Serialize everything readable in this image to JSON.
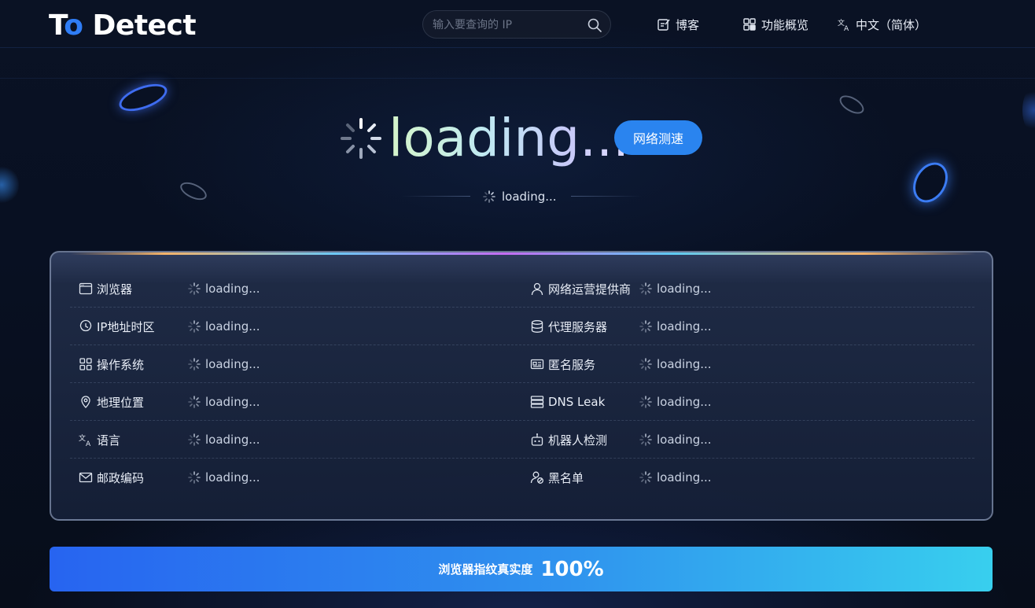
{
  "header": {
    "logo_text_a": "T",
    "logo_text_o": "o",
    "logo_text_b": " Detect",
    "search_placeholder": "输入要查询的 IP",
    "nav": {
      "blog": "博客",
      "features": "功能概览",
      "language": "中文（简体）"
    }
  },
  "hero": {
    "title": "loading...",
    "speed_test_button": "网络测速",
    "subtitle": "loading..."
  },
  "info": {
    "left": [
      {
        "label": "浏览器",
        "value": "loading...",
        "icon": "browser-icon"
      },
      {
        "label": "IP地址时区",
        "value": "loading...",
        "icon": "clock-icon"
      },
      {
        "label": "操作系统",
        "value": "loading...",
        "icon": "grid-icon"
      },
      {
        "label": "地理位置",
        "value": "loading...",
        "icon": "location-pin-icon"
      },
      {
        "label": "语言",
        "value": "loading...",
        "icon": "translate-icon"
      },
      {
        "label": "邮政编码",
        "value": "loading...",
        "icon": "mail-icon"
      }
    ],
    "right": [
      {
        "label": "网络运营提供商",
        "value": "loading...",
        "icon": "person-icon"
      },
      {
        "label": "代理服务器",
        "value": "loading...",
        "icon": "database-icon"
      },
      {
        "label": "匿名服务",
        "value": "loading...",
        "icon": "id-card-icon"
      },
      {
        "label": "DNS Leak",
        "value": "loading...",
        "icon": "server-list-icon"
      },
      {
        "label": "机器人检测",
        "value": "loading...",
        "icon": "robot-icon"
      },
      {
        "label": "黑名单",
        "value": "loading...",
        "icon": "user-block-icon"
      }
    ]
  },
  "score": {
    "label": "浏览器指纹真实度",
    "value": "100%"
  },
  "colors": {
    "accent": "#2a84ef",
    "background": "#070d1a",
    "bar_start": "#2764f0",
    "bar_end": "#38cfee"
  }
}
